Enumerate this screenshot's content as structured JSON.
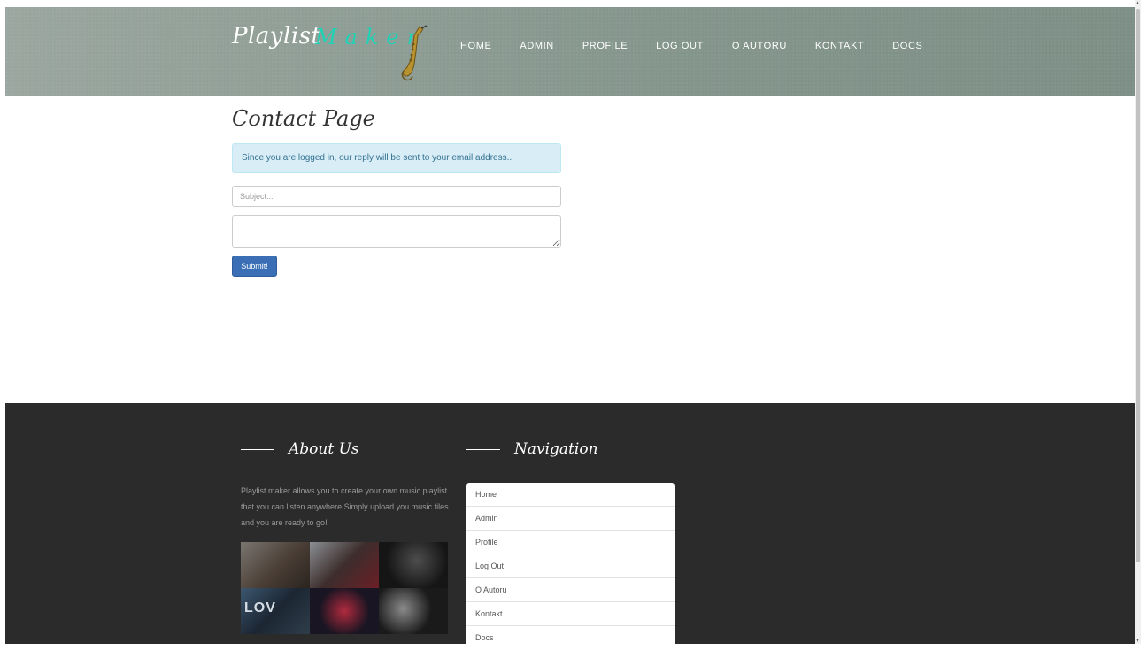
{
  "header": {
    "logo_part1": "Playlist",
    "logo_part2": "Maker",
    "logo_icon": "saxophone-icon",
    "nav": [
      "HOME",
      "ADMIN",
      "PROFILE",
      "LOG OUT",
      "O AUTORU",
      "KONTAKT",
      "DOCS"
    ]
  },
  "main": {
    "title": "Contact Page",
    "alert": "Since you are logged in, our reply will be sent to your email address...",
    "subject_placeholder": "Subject...",
    "message_value": "",
    "submit_label": "Submit!"
  },
  "footer": {
    "about_heading": "About Us",
    "about_text": "Playlist maker allows you to create your own music playlist that you can listen anywhere.Simply upload you music files and you are ready to go!",
    "gallery_overlay_text": "LOV",
    "nav_heading": "Navigation",
    "nav_items": [
      "Home",
      "Admin",
      "Profile",
      "Log Out",
      "O Autoru",
      "Kontakt",
      "Docs"
    ]
  },
  "colors": {
    "accent_teal": "#1fd3b6",
    "header_bg": "#8d9c94",
    "footer_bg": "#2b2b2b",
    "primary_button": "#3a6fb5",
    "alert_bg": "#d9edf7",
    "alert_text": "#31708f"
  }
}
